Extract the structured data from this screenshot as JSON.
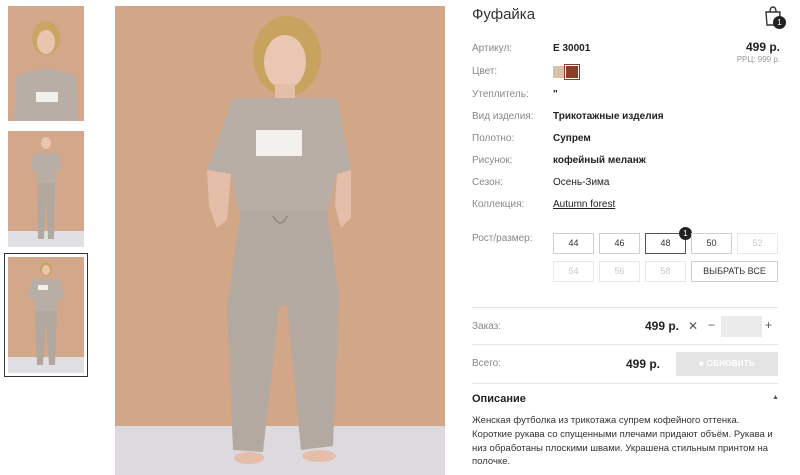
{
  "product": {
    "title": "Фуфайка",
    "price": "499 р.",
    "rrp": "РРЦ: 999 р.",
    "cart_count": "1"
  },
  "attributes": {
    "article_label": "Артикул:",
    "article_value": "Е 30001",
    "color_label": "Цвет:",
    "insulation_label": "Утеплитель:",
    "insulation_value": "\"",
    "type_label": "Вид изделия:",
    "type_value": "Трикотажные изделия",
    "fabric_label": "Полотно:",
    "fabric_value": "Супрем",
    "pattern_label": "Рисунок:",
    "pattern_value": "кофейный меланж",
    "season_label": "Сезон:",
    "season_value": "Осень-Зима",
    "collection_label": "Коллекция:",
    "collection_value": "Autumn forest"
  },
  "colors": {
    "beige": "#d9c3a6",
    "brown": "#8b3f26"
  },
  "sizes": {
    "label": "Рост/размер:",
    "items": [
      "44",
      "46",
      "48",
      "50",
      "52",
      "54",
      "56",
      "58"
    ],
    "selected_badge": "1",
    "select_all": "ВЫБРАТЬ ВСЕ"
  },
  "order": {
    "label": "Заказ:",
    "price": "499 р.",
    "remove": "✕",
    "minus": "−",
    "plus": "+"
  },
  "total": {
    "label": "Всего:",
    "price": "499 р.",
    "refresh_label": "ОБНОВИТЬ"
  },
  "description": {
    "title": "Описание",
    "toggle": "▲",
    "text": "Женская футболка из трикотажа супрем кофейного оттенка. Короткие рукава со спущенными плечами придают объём. Рукава и низ обработаны плоскими швами. Украшена стильным принтом на полочке."
  }
}
